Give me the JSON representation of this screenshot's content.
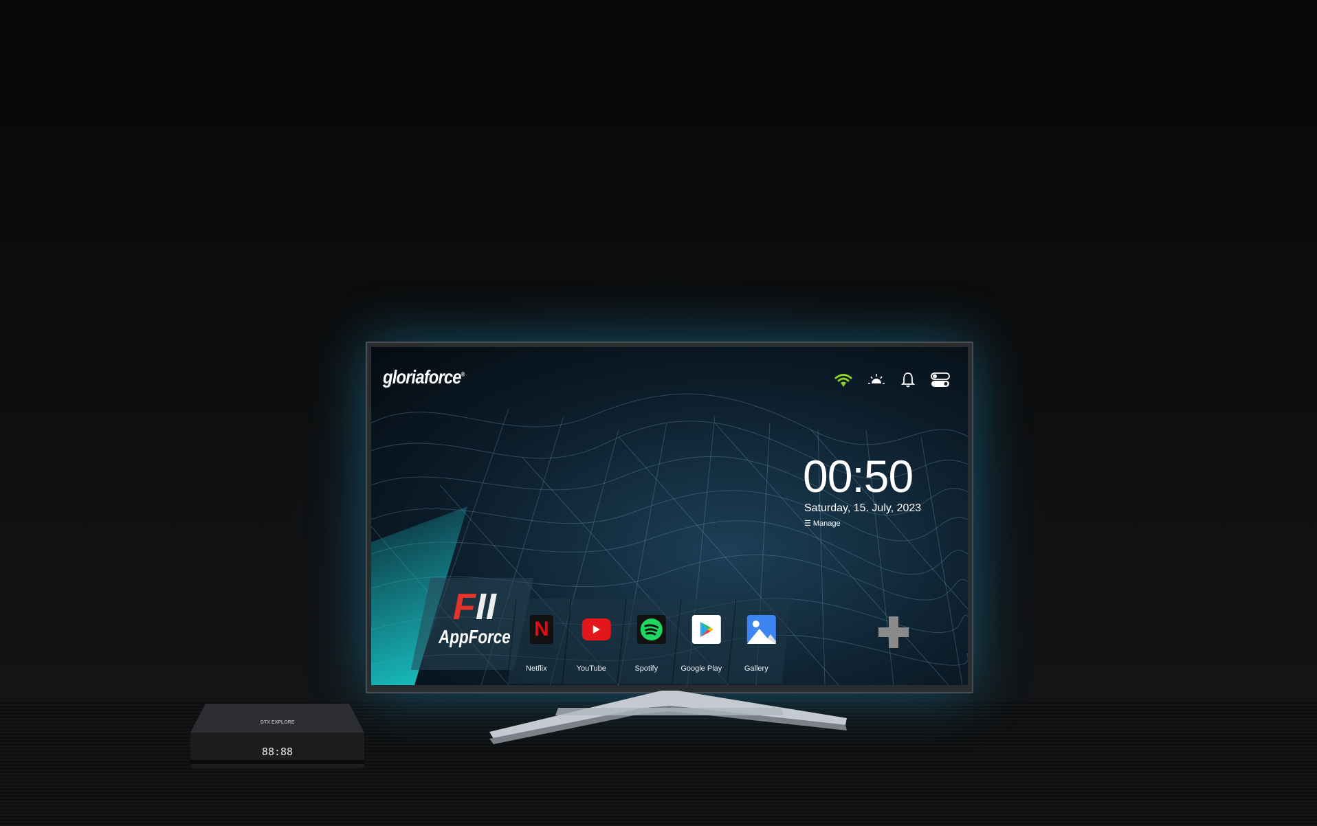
{
  "brand": {
    "logo": "gloriaforce",
    "reg": "®"
  },
  "status_icons": [
    "wifi-icon",
    "brightness-icon",
    "bell-icon",
    "toggle-icon"
  ],
  "colors": {
    "wifi": "#8fd12a",
    "accent_teal": "#19c8c8",
    "netflix": "#e50914",
    "youtube": "#ff0000",
    "spotify": "#1ed760"
  },
  "clock": {
    "time": "00:50",
    "date": "Saturday, 15. July, 2023",
    "manage": "Manage"
  },
  "appforce": {
    "mark_f": "F",
    "mark_ii": "II",
    "name": "AppForce"
  },
  "apps": [
    {
      "label": "Netflix",
      "icon": "netflix-icon"
    },
    {
      "label": "YouTube",
      "icon": "youtube-icon"
    },
    {
      "label": "Spotify",
      "icon": "spotify-icon"
    },
    {
      "label": "Google Play",
      "icon": "google-play-icon"
    },
    {
      "label": "Gallery",
      "icon": "gallery-icon"
    }
  ],
  "device": {
    "brand": "GTX EXPLORE",
    "display": "88:88"
  }
}
